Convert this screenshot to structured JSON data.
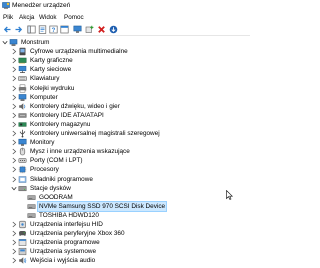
{
  "window": {
    "title": "Menedżer urządzeń"
  },
  "menu": [
    {
      "label": "Plik",
      "name": "menu-plik"
    },
    {
      "label": "Akcja",
      "name": "menu-akcja"
    },
    {
      "label": "Widok",
      "name": "menu-widok"
    },
    {
      "label": "Pomoc",
      "name": "menu-pomoc"
    }
  ],
  "toolbar": [
    {
      "name": "back-button",
      "icon": "arrow-left-icon"
    },
    {
      "name": "forward-button",
      "icon": "arrow-right-icon"
    },
    {
      "name": "show-hide-console-tree-button",
      "icon": "console-tree-icon"
    },
    {
      "name": "properties-button",
      "icon": "properties-icon"
    },
    {
      "name": "help-button",
      "icon": "help-icon"
    },
    {
      "name": "view-panel-button",
      "icon": "panel-icon"
    },
    {
      "name": "scan-hardware-button",
      "icon": "monitor-scan-icon"
    },
    {
      "name": "add-driver-button",
      "icon": "driver-add-icon"
    },
    {
      "name": "uninstall-device-button",
      "icon": "red-x-icon"
    },
    {
      "name": "update-driver-button",
      "icon": "download-arrow-icon"
    }
  ],
  "tree": {
    "root": {
      "label": "Monstrum",
      "icon": "computer-icon",
      "expanded": true
    },
    "categories": [
      {
        "label": "Cyfrowe urządzenia multimedialne",
        "icon": "media-icon",
        "expanded": false
      },
      {
        "label": "Karty graficzne",
        "icon": "display-adapter-icon",
        "expanded": false
      },
      {
        "label": "Karty sieciowe",
        "icon": "network-adapter-icon",
        "expanded": false
      },
      {
        "label": "Klawiatury",
        "icon": "keyboard-icon",
        "expanded": false
      },
      {
        "label": "Kolejki wydruku",
        "icon": "printer-icon",
        "expanded": false
      },
      {
        "label": "Komputer",
        "icon": "computer-icon",
        "expanded": false
      },
      {
        "label": "Kontrolery dźwięku, wideo i gier",
        "icon": "audio-icon",
        "expanded": false
      },
      {
        "label": "Kontrolery IDE ATA/ATAPI",
        "icon": "ide-icon",
        "expanded": false
      },
      {
        "label": "Kontrolery magazynu",
        "icon": "storage-controller-icon",
        "expanded": false
      },
      {
        "label": "Kontrolery uniwersalnej magistrali szeregowej",
        "icon": "usb-icon",
        "expanded": false
      },
      {
        "label": "Monitory",
        "icon": "monitor-icon",
        "expanded": false
      },
      {
        "label": "Mysz i inne urządzenia wskazujące",
        "icon": "mouse-icon",
        "expanded": false
      },
      {
        "label": "Porty (COM i LPT)",
        "icon": "port-icon",
        "expanded": false
      },
      {
        "label": "Procesory",
        "icon": "processor-icon",
        "expanded": false
      },
      {
        "label": "Składniki programowe",
        "icon": "software-component-icon",
        "expanded": false
      },
      {
        "label": "Stacje dysków",
        "icon": "disk-drive-icon",
        "expanded": true,
        "children": [
          {
            "label": "GOODRAM",
            "icon": "disk-icon",
            "selected": false
          },
          {
            "label": "NVMe Samsung SSD 970 SCSI Disk Device",
            "icon": "disk-icon",
            "selected": true
          },
          {
            "label": "TOSHIBA HDWD120",
            "icon": "disk-icon",
            "selected": false
          }
        ]
      },
      {
        "label": "Urządzenia interfejsu HID",
        "icon": "hid-icon",
        "expanded": false
      },
      {
        "label": "Urządzenia peryferyjne Xbox 360",
        "icon": "xbox-icon",
        "expanded": false
      },
      {
        "label": "Urządzenia programowe",
        "icon": "software-device-icon",
        "expanded": false
      },
      {
        "label": "Urządzenia systemowe",
        "icon": "system-device-icon",
        "expanded": false
      },
      {
        "label": "Wejścia i wyjścia audio",
        "icon": "audio-io-icon",
        "expanded": false
      }
    ]
  },
  "colors": {
    "selection": "#cce8ff",
    "selection_border": "#99d1ff",
    "icon_blue": "#2f7fd0",
    "delete_red": "#d21f1f"
  }
}
